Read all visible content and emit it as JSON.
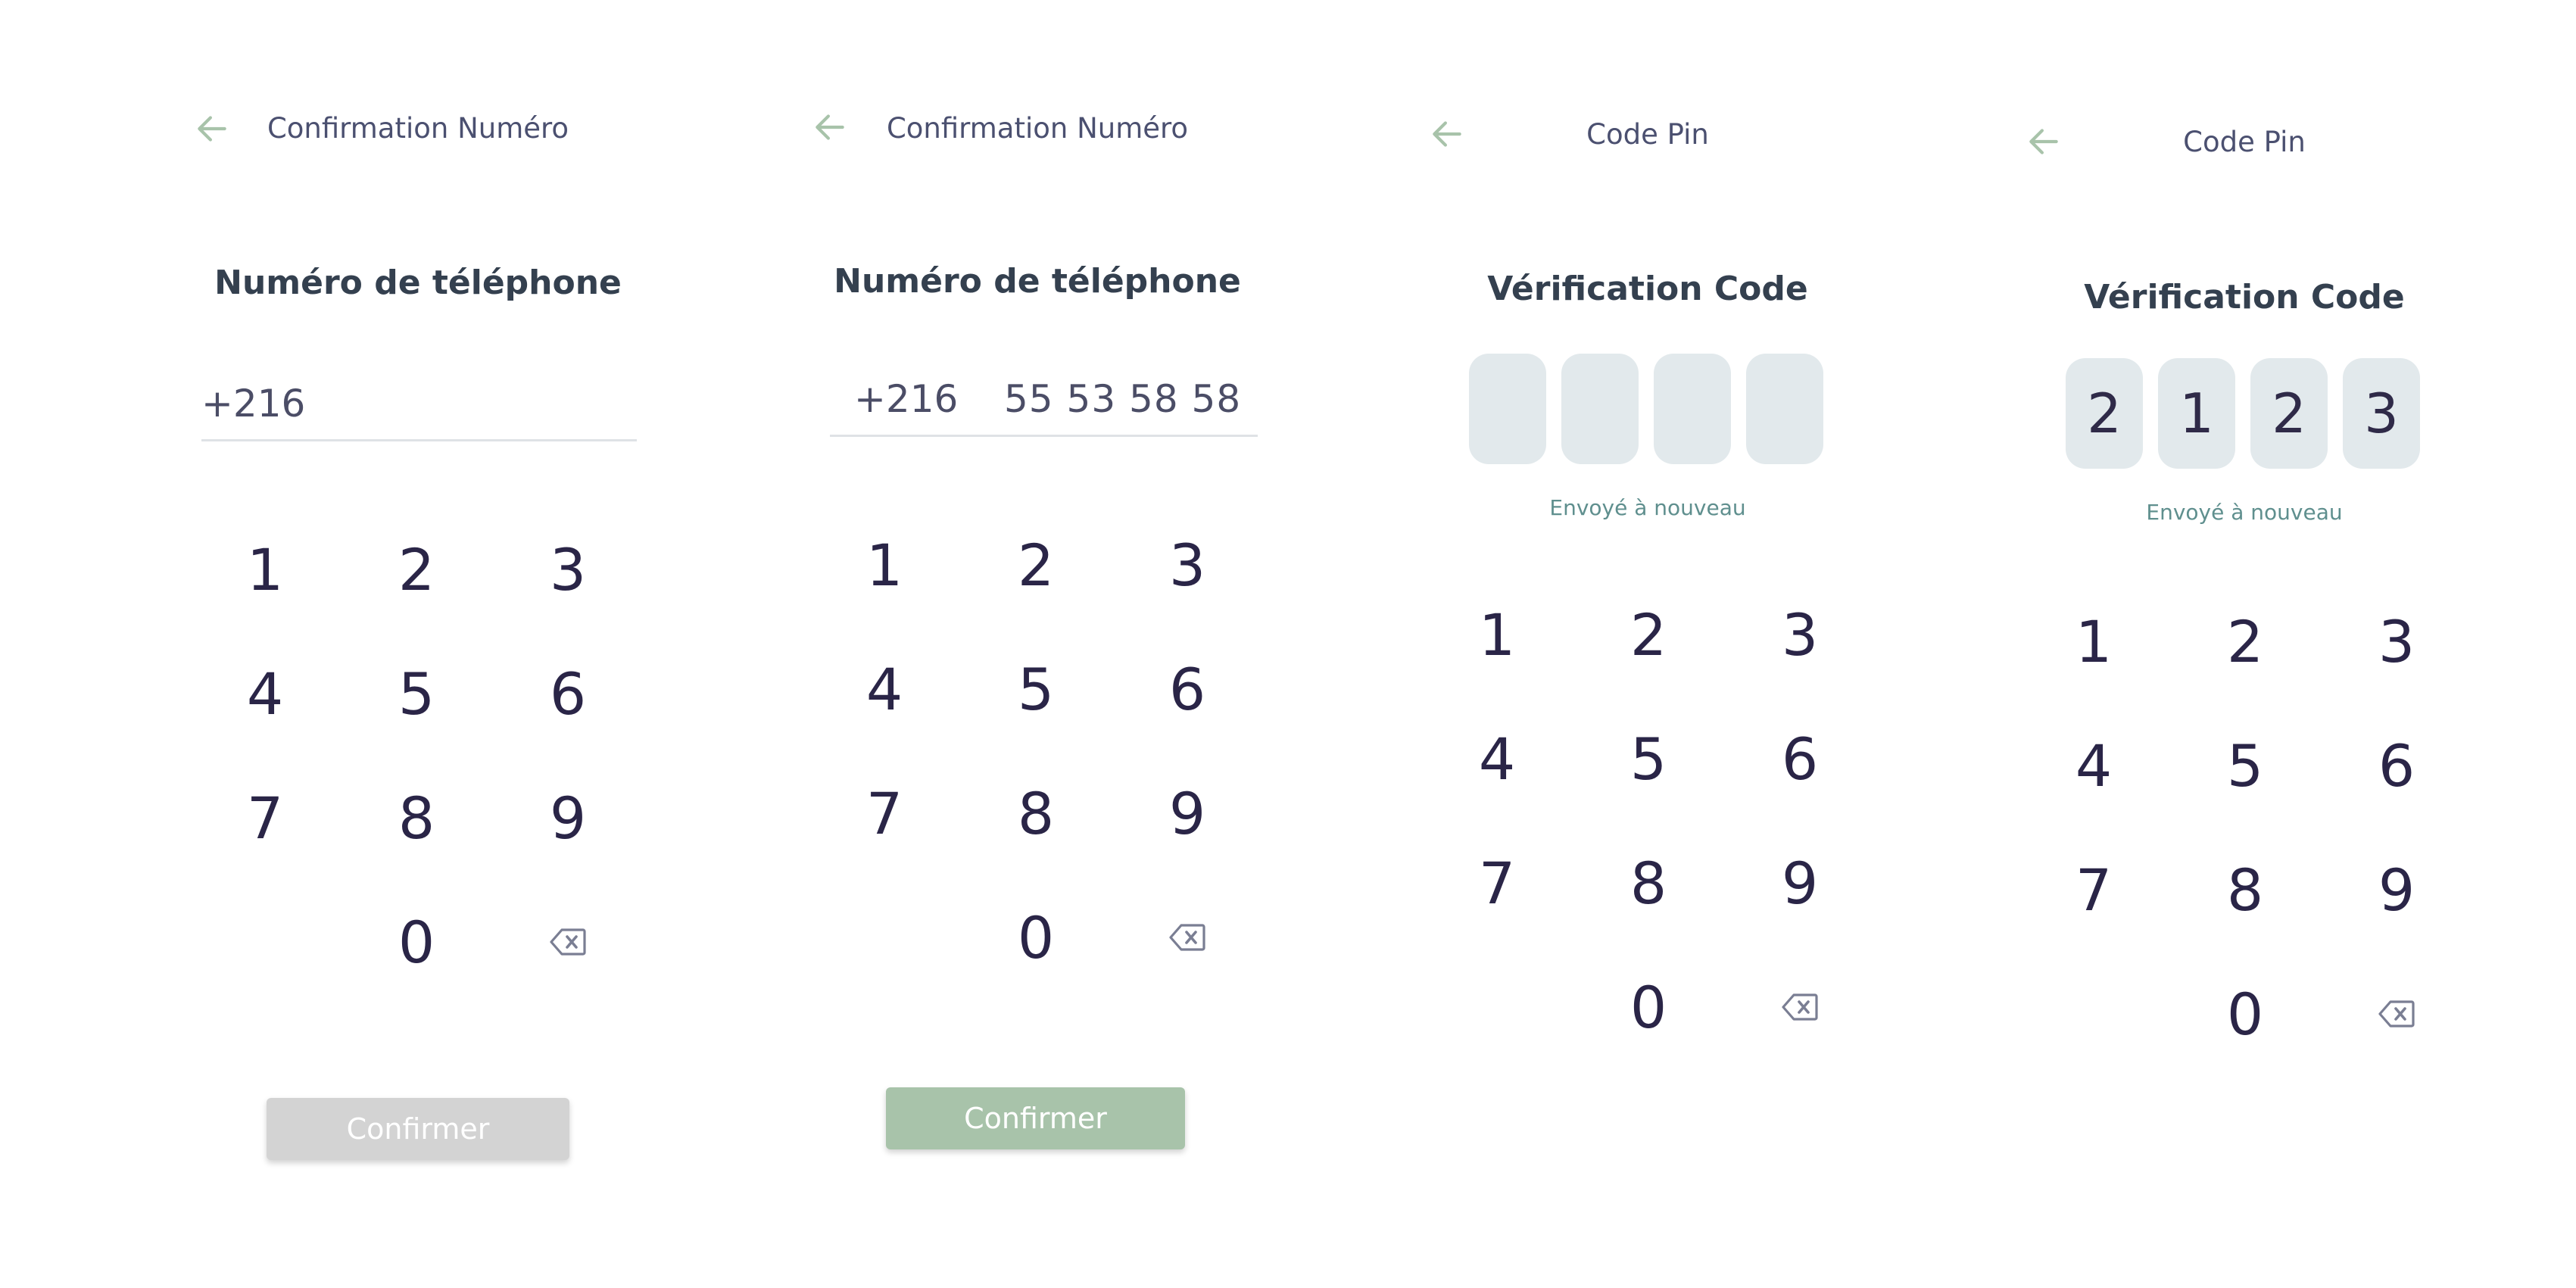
{
  "colors": {
    "accent": "#a8c3aa",
    "disabled": "#d3d3d3",
    "pin_box": "#e2e9ec",
    "title": "#4b5070",
    "heading": "#34404f",
    "resend": "#5f8f8e"
  },
  "icons": {
    "back": "arrow-left-icon",
    "delete": "backspace-icon"
  },
  "screens": [
    {
      "title": "Confirmation Numéro",
      "heading": "Numéro de téléphone",
      "phone": {
        "prefix": "+216",
        "number": ""
      },
      "keys": [
        "1",
        "2",
        "3",
        "4",
        "5",
        "6",
        "7",
        "8",
        "9",
        "",
        "0",
        "⌫"
      ],
      "button": {
        "label": "Confirmer",
        "state": "disabled"
      }
    },
    {
      "title": "Confirmation Numéro",
      "heading": "Numéro de téléphone",
      "phone": {
        "prefix": "+216",
        "number": "55 53 58 58"
      },
      "keys": [
        "1",
        "2",
        "3",
        "4",
        "5",
        "6",
        "7",
        "8",
        "9",
        "",
        "0",
        "⌫"
      ],
      "button": {
        "label": "Confirmer",
        "state": "active"
      }
    },
    {
      "title": "Code Pin",
      "heading": "Vérification Code",
      "pin": [
        "",
        "",
        "",
        ""
      ],
      "resend": "Envoyé à nouveau",
      "keys": [
        "1",
        "2",
        "3",
        "4",
        "5",
        "6",
        "7",
        "8",
        "9",
        "",
        "0",
        "⌫"
      ]
    },
    {
      "title": "Code Pin",
      "heading": "Vérification Code",
      "pin": [
        "2",
        "1",
        "2",
        "3"
      ],
      "resend": "Envoyé à nouveau",
      "keys": [
        "1",
        "2",
        "3",
        "4",
        "5",
        "6",
        "7",
        "8",
        "9",
        "",
        "0",
        "⌫"
      ]
    }
  ]
}
